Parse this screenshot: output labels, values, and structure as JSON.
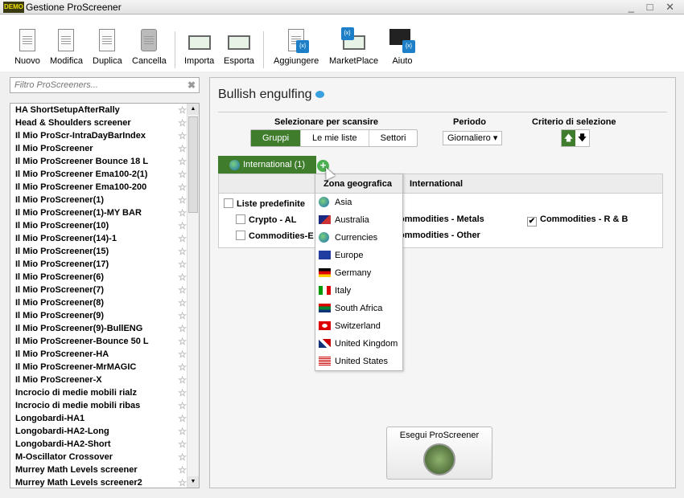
{
  "window": {
    "title": "Gestione ProScreener",
    "logo": "DEMO"
  },
  "toolbar": [
    {
      "label": "Nuovo",
      "icon": "new-doc-icon"
    },
    {
      "label": "Modifica",
      "icon": "edit-icon"
    },
    {
      "label": "Duplica",
      "icon": "duplicate-icon"
    },
    {
      "label": "Cancella",
      "icon": "trash-icon"
    },
    {
      "label": "Importa",
      "icon": "import-icon"
    },
    {
      "label": "Esporta",
      "icon": "export-icon"
    },
    {
      "label": "Aggiungere",
      "icon": "add-icon"
    },
    {
      "label": "MarketPlace",
      "icon": "marketplace-icon"
    },
    {
      "label": "Aiuto",
      "icon": "help-icon"
    }
  ],
  "filter": {
    "placeholder": "Filtro ProScreeners..."
  },
  "screeners": [
    "HA ShortSetupAfterRally",
    "Head & Shoulders screener",
    "Il Mio ProScr-IntraDayBarIndex",
    "Il Mio ProScreener",
    "Il Mio ProScreener Bounce 18 L",
    "Il Mio ProScreener Ema100-2(1)",
    "Il Mio ProScreener Ema100-200",
    "Il Mio ProScreener(1)",
    "Il Mio ProScreener(1)-MY BAR",
    "Il Mio ProScreener(10)",
    "Il Mio ProScreener(14)-1",
    "Il Mio ProScreener(15)",
    "Il Mio ProScreener(17)",
    "Il Mio ProScreener(6)",
    "Il Mio ProScreener(7)",
    "Il Mio ProScreener(8)",
    "Il Mio ProScreener(9)",
    "Il Mio ProScreener(9)-BullENG",
    "Il Mio ProScreener-Bounce 50 L",
    "Il Mio ProScreener-HA",
    "Il Mio ProScreener-MrMAGIC",
    "Il Mio ProScreener-X",
    "Incrocio di medie mobili rialz",
    "Incrocio di medie mobili ribas",
    "Longobardi-HA1",
    "Longobardi-HA2-Long",
    "Longobardi-HA2-Short",
    "M-Oscillator Crossover",
    "Murrey Math Levels screener",
    "Murrey Math Levels screener2"
  ],
  "main": {
    "title": "Bullish engulfing",
    "scan_label": "Selezionare per scansire",
    "scan_tabs": [
      "Gruppi",
      "Le mie liste",
      "Settori"
    ],
    "period_label": "Periodo",
    "period_value": "Giornaliero ▾",
    "criteria_label": "Criterio di selezione",
    "criteria_up": "🡅",
    "criteria_down": "🡇",
    "group_tab": "International (1)",
    "table_header": "International",
    "rows": {
      "predef": "Liste predefinite",
      "crypto": "Crypto - AL",
      "commb": "Commodities-E",
      "metals": "ommodities - Metals",
      "other": "ommodities - Other",
      "rb": "Commodities - R & B",
      "rb_check": "✔"
    },
    "dropdown": {
      "header": "Zona geografica",
      "items": [
        "Asia",
        "Australia",
        "Currencies",
        "Europe",
        "Germany",
        "Italy",
        "South Africa",
        "Switzerland",
        "United Kingdom",
        "United States"
      ]
    },
    "run_button": "Esegui ProScreener"
  }
}
